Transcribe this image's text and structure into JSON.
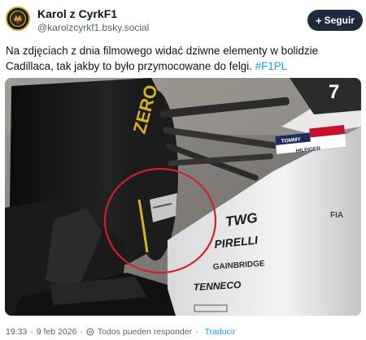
{
  "author": {
    "name": "Karol z CyrkF1",
    "handle": "@karolzcyrkf1.bsky.social"
  },
  "follow_button": {
    "label": "Seguir",
    "icon": "plus-icon"
  },
  "post": {
    "text": "Na zdjęciach z dnia filmowego widać dziwne elementy w bolidzie Cadillaca, tak jakby to było przymocowane do felgi.",
    "hashtag": "#F1PL"
  },
  "media": {
    "sponsors": {
      "tommy": "TOMMY",
      "hilfiger": "HILFIGER",
      "twg": "TWG",
      "pirelli": "PIRELLI",
      "gainbridge": "GAINBRIDGE",
      "tenneco": "TENNECO",
      "tyre": "ZERO",
      "number": "7",
      "fia": "FIA"
    },
    "highlight_color": "#d0202a"
  },
  "footer": {
    "time": "19:33",
    "dot": "·",
    "date": "9 feb 2026",
    "reply_setting": "Todos pueden responder",
    "translate": "Traducir"
  },
  "colors": {
    "link": "#1d9bf0",
    "follow_bg": "#1e2b3c",
    "muted": "#536471"
  }
}
